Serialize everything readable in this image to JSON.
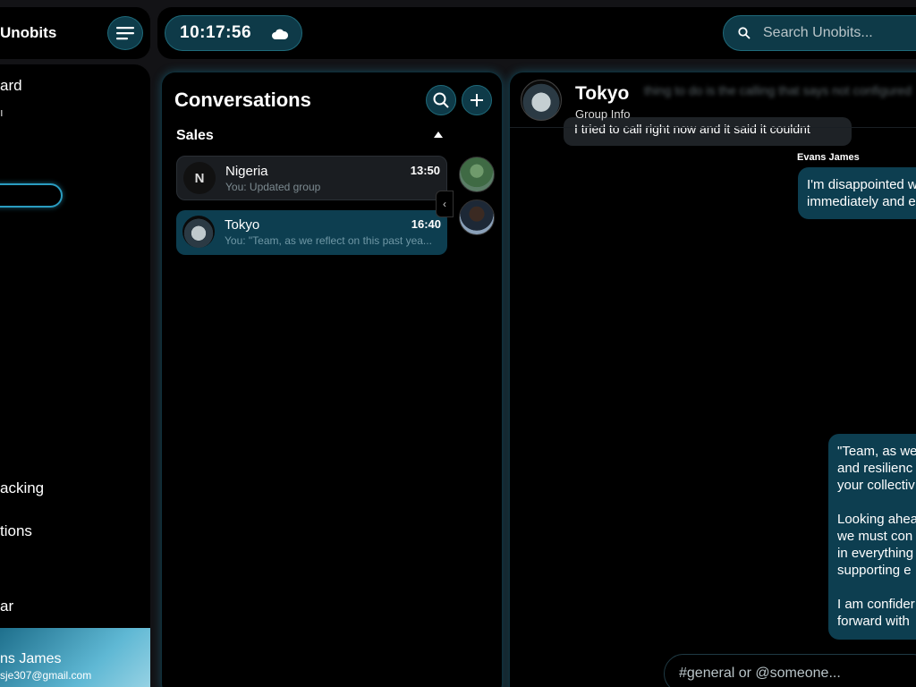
{
  "app": {
    "brand": "Unobits",
    "clock": "10:17:56",
    "weather_icon": "cloud-icon"
  },
  "search": {
    "placeholder": "Search Unobits..."
  },
  "sidebar": {
    "items": [
      {
        "label": "ard"
      },
      {
        "label": "acking"
      },
      {
        "label": "tions"
      },
      {
        "label": "ar"
      }
    ],
    "small_label": "ı",
    "profile": {
      "name": "ns James",
      "email": "sje307@gmail.com"
    }
  },
  "conversations": {
    "title": "Conversations",
    "group": "Sales",
    "items": [
      {
        "name": "Nigeria",
        "avatar_letter": "N",
        "time": "13:50",
        "preview": "You: Updated group"
      },
      {
        "name": "Tokyo",
        "time": "16:40",
        "preview": "You: \"Team, as we reflect on this past yea..."
      }
    ],
    "collapse_glyph": "‹"
  },
  "chat": {
    "title": "Tokyo",
    "subtitle": "Group Info",
    "blurred_header_text": "thing to do is the calling that says not configured",
    "grey_message": "I tried to call right now and it said it couldnt",
    "sender": "Evans James",
    "message1": [
      "I'm disappointed w",
      "immediately and e"
    ],
    "message2": [
      [
        "\"Team, as we",
        "and resilienc",
        "your collectiv"
      ],
      [
        "Looking ahea",
        "we must con",
        "in everything",
        "supporting e"
      ],
      [
        "I am confider",
        "forward with"
      ]
    ],
    "composer_placeholder": "#general or @someone..."
  },
  "colors": {
    "accent": "#0d3e50",
    "accent_border": "#1f6a7a",
    "glow": "#2a9cc0",
    "panel": "#000000",
    "background": "#131316"
  }
}
